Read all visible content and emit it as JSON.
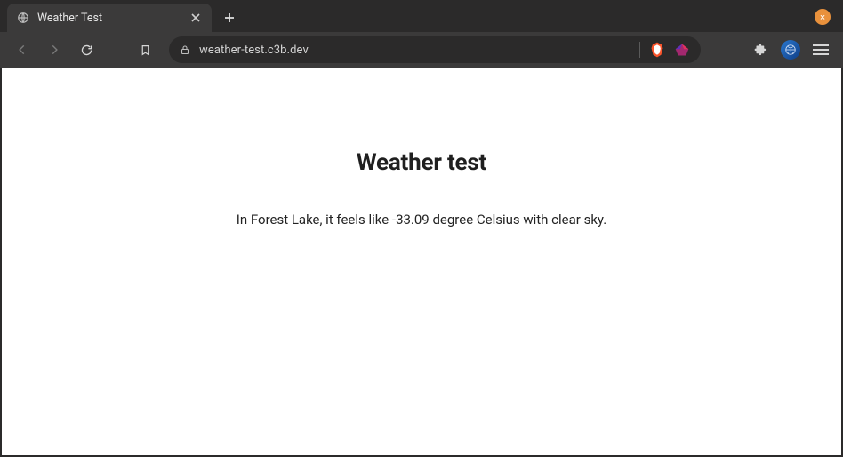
{
  "window": {
    "close_label": "×"
  },
  "tabs": {
    "active": {
      "title": "Weather Test"
    }
  },
  "toolbar": {
    "url": "weather-test.c3b.dev"
  },
  "page": {
    "heading": "Weather test",
    "sentence": "In Forest Lake, it feels like -33.09 degree Celsius with clear sky."
  }
}
